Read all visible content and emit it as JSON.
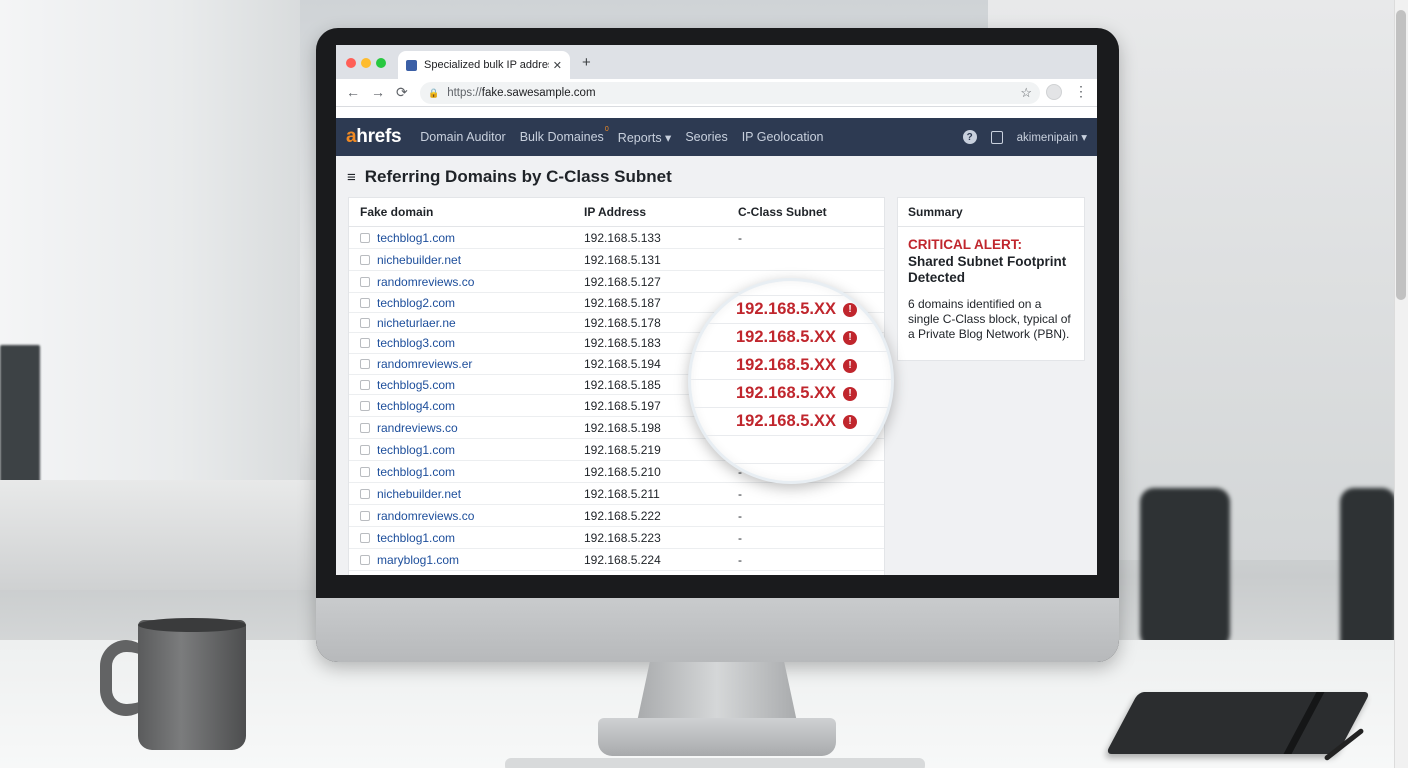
{
  "browser": {
    "tab_title": "Specialized bulk IP address",
    "tab_close": "✕",
    "new_tab": "+",
    "url_scheme": "https://",
    "url_host": "fake.sawesample.com",
    "back": "←",
    "forward": "→",
    "reload": "⟳",
    "star": "☆",
    "menu": "⋮"
  },
  "appnav": {
    "logo_a": "a",
    "logo_rest": "hrefs",
    "items": [
      "Domain Auditor",
      "Bulk Domaines",
      "Reports ▾",
      "Seories",
      "IP Geolocation"
    ],
    "bulk_badge": "0",
    "help": "?",
    "user": "akimenipain ▾"
  },
  "page": {
    "menu_icon": "≡",
    "title": "Referring Domains by C-Class Subnet"
  },
  "table": {
    "headers": [
      "Fake domain",
      "IP Address",
      "C-Class Subnet"
    ],
    "rows": [
      {
        "domain": "techblog1.com",
        "ip": "192.168.5.133",
        "subnet": "-"
      },
      {
        "domain": "nichebuilder.net",
        "ip": "192.168.5.131",
        "subnet": ""
      },
      {
        "domain": "randomreviews.co",
        "ip": "192.168.5.127",
        "subnet": ""
      },
      {
        "domain": "techblog2.com",
        "ip": "192.168.5.187",
        "subnet": ""
      },
      {
        "domain": "nicheturlaer.ne",
        "ip": "192.168.5.178",
        "subnet": ""
      },
      {
        "domain": "techblog3.com",
        "ip": "192.168.5.183",
        "subnet": ""
      },
      {
        "domain": "randomreviews.er",
        "ip": "192.168.5.194",
        "subnet": ""
      },
      {
        "domain": "techblog5.com",
        "ip": "192.168.5.185",
        "subnet": ""
      },
      {
        "domain": "techblog4.com",
        "ip": "192.168.5.197",
        "subnet": ""
      },
      {
        "domain": "randreviews.co",
        "ip": "192.168.5.198",
        "subnet": ""
      },
      {
        "domain": "techblog1.com",
        "ip": "192.168.5.219",
        "subnet": "-"
      },
      {
        "domain": "techblog1.com",
        "ip": "192.168.5.210",
        "subnet": "-"
      },
      {
        "domain": "nichebuilder.net",
        "ip": "192.168.5.211",
        "subnet": "-"
      },
      {
        "domain": "randomreviews.co",
        "ip": "192.168.5.222",
        "subnet": "-"
      },
      {
        "domain": "techblog1.com",
        "ip": "192.168.5.223",
        "subnet": "-"
      },
      {
        "domain": "maryblog1.com",
        "ip": "192.168.5.224",
        "subnet": "-"
      }
    ]
  },
  "magnifier": {
    "subnets": [
      "192.168.5.XX",
      "192.168.5.XX",
      "192.168.5.XX",
      "192.168.5.XX",
      "192.168.5.XX"
    ],
    "warn_glyph": "!"
  },
  "summary": {
    "title": "Summary",
    "alert_red": "CRITICAL ALERT:",
    "alert_black": "Shared Subnet Footprint Detected",
    "body": "6 domains identified on a single C-Class block, typical of a Private Blog Network (PBN)."
  },
  "colors": {
    "nav_bg": "#2d3a52",
    "logo_accent": "#f08a24",
    "alert_red": "#c0262d",
    "link_blue": "#1d4e9b"
  }
}
